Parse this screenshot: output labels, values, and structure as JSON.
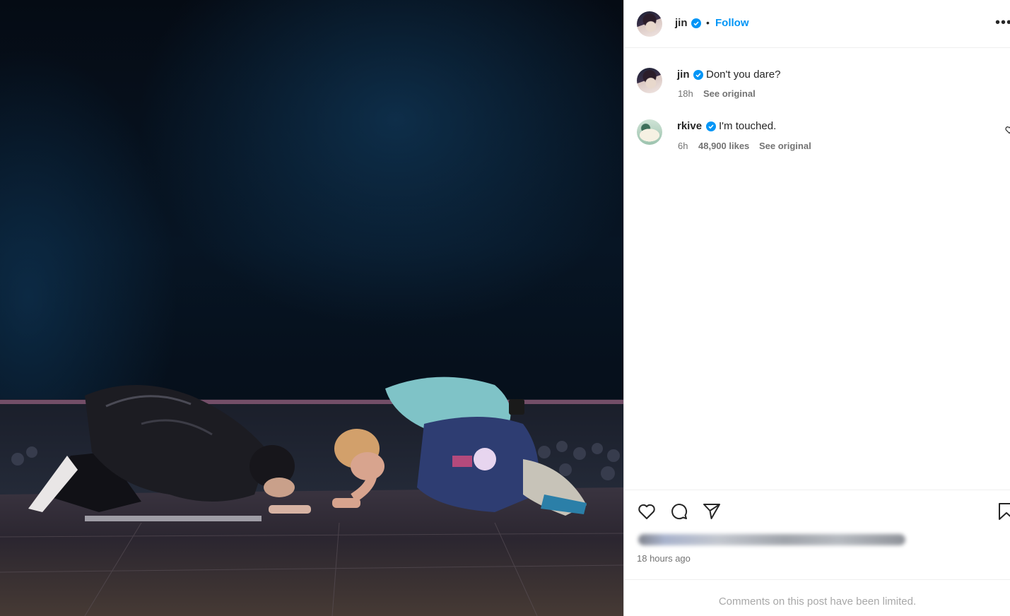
{
  "post": {
    "author": {
      "username": "jin",
      "verified": true
    },
    "follow_label": "Follow",
    "separator": "•",
    "more_label": "•••"
  },
  "comments": [
    {
      "username": "jin",
      "verified": true,
      "text": "Don't you dare?",
      "time": "18h",
      "likes": "",
      "see_original": "See original"
    },
    {
      "username": "rkive",
      "verified": true,
      "text": "I'm touched.",
      "time": "6h",
      "likes": "48,900 likes",
      "see_original": "See original"
    }
  ],
  "actions": {
    "icons": [
      "heart-icon",
      "comment-icon",
      "share-icon",
      "bookmark-icon"
    ],
    "time_ago": "18 hours ago"
  },
  "footer": {
    "limited_text": "Comments on this post have been limited."
  },
  "colors": {
    "accent": "#0095f6",
    "verified": "#0095f6",
    "muted": "#737373"
  }
}
